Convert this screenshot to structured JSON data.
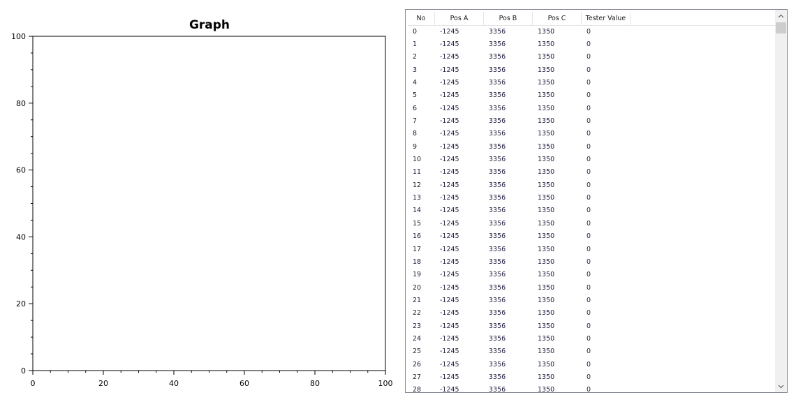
{
  "chart_data": {
    "type": "line",
    "title": "Graph",
    "xlabel": "",
    "ylabel": "",
    "xlim": [
      0,
      100
    ],
    "ylim": [
      0,
      100
    ],
    "x_ticks": [
      "0",
      "20",
      "40",
      "60",
      "80",
      "100"
    ],
    "y_ticks": [
      "0",
      "20",
      "40",
      "60",
      "80",
      "100"
    ],
    "grid": false,
    "series": []
  },
  "table": {
    "columns": [
      "No",
      "Pos A",
      "Pos B",
      "Pos C",
      "Tester Value"
    ],
    "rows": [
      [
        "0",
        "-1245",
        "3356",
        "1350",
        "0"
      ],
      [
        "1",
        "-1245",
        "3356",
        "1350",
        "0"
      ],
      [
        "2",
        "-1245",
        "3356",
        "1350",
        "0"
      ],
      [
        "3",
        "-1245",
        "3356",
        "1350",
        "0"
      ],
      [
        "4",
        "-1245",
        "3356",
        "1350",
        "0"
      ],
      [
        "5",
        "-1245",
        "3356",
        "1350",
        "0"
      ],
      [
        "6",
        "-1245",
        "3356",
        "1350",
        "0"
      ],
      [
        "7",
        "-1245",
        "3356",
        "1350",
        "0"
      ],
      [
        "8",
        "-1245",
        "3356",
        "1350",
        "0"
      ],
      [
        "9",
        "-1245",
        "3356",
        "1350",
        "0"
      ],
      [
        "10",
        "-1245",
        "3356",
        "1350",
        "0"
      ],
      [
        "11",
        "-1245",
        "3356",
        "1350",
        "0"
      ],
      [
        "12",
        "-1245",
        "3356",
        "1350",
        "0"
      ],
      [
        "13",
        "-1245",
        "3356",
        "1350",
        "0"
      ],
      [
        "14",
        "-1245",
        "3356",
        "1350",
        "0"
      ],
      [
        "15",
        "-1245",
        "3356",
        "1350",
        "0"
      ],
      [
        "16",
        "-1245",
        "3356",
        "1350",
        "0"
      ],
      [
        "17",
        "-1245",
        "3356",
        "1350",
        "0"
      ],
      [
        "18",
        "-1245",
        "3356",
        "1350",
        "0"
      ],
      [
        "19",
        "-1245",
        "3356",
        "1350",
        "0"
      ],
      [
        "20",
        "-1245",
        "3356",
        "1350",
        "0"
      ],
      [
        "21",
        "-1245",
        "3356",
        "1350",
        "0"
      ],
      [
        "22",
        "-1245",
        "3356",
        "1350",
        "0"
      ],
      [
        "23",
        "-1245",
        "3356",
        "1350",
        "0"
      ],
      [
        "24",
        "-1245",
        "3356",
        "1350",
        "0"
      ],
      [
        "25",
        "-1245",
        "3356",
        "1350",
        "0"
      ],
      [
        "26",
        "-1245",
        "3356",
        "1350",
        "0"
      ],
      [
        "27",
        "-1245",
        "3356",
        "1350",
        "0"
      ],
      [
        "28",
        "-1245",
        "3356",
        "1350",
        "0"
      ]
    ]
  },
  "scrollbar": {
    "up_icon": "chevron-up-icon",
    "down_icon": "chevron-down-icon"
  }
}
